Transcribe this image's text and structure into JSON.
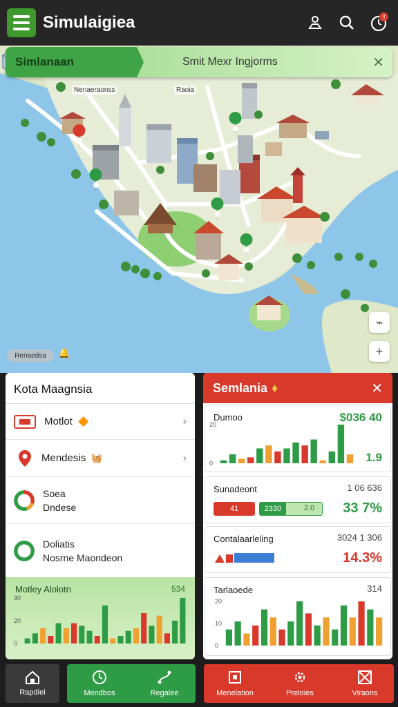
{
  "app": {
    "title": "Simulaigiea"
  },
  "header": {
    "icons": [
      "menu-icon",
      "user-pin-icon",
      "search-icon",
      "notification-clock-icon"
    ],
    "notification_badge": "!!"
  },
  "banner": {
    "left_text": "Simlanaan",
    "right_text": "Smit Mexr Ingjorms",
    "close": "✕"
  },
  "map": {
    "labels": [
      "Nenaeraonss",
      "Raoia"
    ],
    "chip": "Renaedsa",
    "zoom_in": "+",
    "zoom_out": "⌁"
  },
  "left_panel": {
    "title": "Kota Maagnsia",
    "items": [
      {
        "label": "Motlot",
        "icon": "ticket-icon",
        "has_chevron": true
      },
      {
        "label": "Mendesis",
        "icon": "map-pin-icon",
        "has_chevron": true
      },
      {
        "label_line1": "Soea",
        "label_line2": "Dndese",
        "icon": "progress-ring-icon"
      },
      {
        "label_line1": "Doliatis",
        "label_line2": "Nosrne Maondeon",
        "icon": "progress-ring-icon"
      }
    ],
    "chart": {
      "title": "Motley Alolotn",
      "value": "534",
      "colors": {
        "green": "#2e9b45",
        "red": "#d8392b",
        "orange": "#f0a030"
      }
    }
  },
  "right_panel": {
    "title": "Semlania",
    "close": "✕",
    "sections": [
      {
        "title": "Dumoo",
        "value": "$036 40",
        "value2": "1.9"
      },
      {
        "title": "Sunadeont",
        "value": "1 06 636",
        "pill1": "2330",
        "pill2": "2.0",
        "pill3": "41",
        "big": "33 7%"
      },
      {
        "title": "Contalaarleling",
        "value": "3024 1 306",
        "big": "14.3%"
      },
      {
        "title": "Tarlaoede",
        "value": "314"
      }
    ]
  },
  "chart_data": [
    {
      "type": "bar",
      "title": "Motley Alolotn",
      "ytick_labels": [
        "30",
        "20",
        "0"
      ],
      "values": [
        4,
        8,
        12,
        6,
        16,
        12,
        16,
        14,
        10,
        6,
        30,
        4,
        6,
        10,
        12,
        24,
        14,
        22,
        8,
        18,
        36
      ]
    },
    {
      "type": "bar",
      "title": "Dumoo",
      "ytick_labels": [
        "20",
        "0"
      ],
      "values": [
        2,
        6,
        3,
        4,
        10,
        12,
        8,
        10,
        14,
        12,
        16,
        2,
        8,
        26,
        6
      ]
    },
    {
      "type": "bar",
      "title": "Tarlaoede",
      "ytick_labels": [
        "20",
        "10",
        "0"
      ],
      "values": [
        8,
        12,
        6,
        10,
        18,
        14,
        8,
        12,
        22,
        16,
        10,
        14,
        8,
        20,
        14,
        22,
        18,
        14
      ]
    }
  ],
  "bottom_nav": {
    "items": [
      {
        "label": "Rapdiei",
        "icon": "home-icon"
      },
      {
        "label": "Mendbos",
        "icon": "clock-icon"
      },
      {
        "label": "Regalee",
        "icon": "route-icon"
      },
      {
        "label": "Menelation",
        "icon": "building-icon"
      },
      {
        "label": "Preloies",
        "icon": "gear-icon"
      },
      {
        "label": "Viraons",
        "icon": "grid-icon"
      }
    ]
  }
}
